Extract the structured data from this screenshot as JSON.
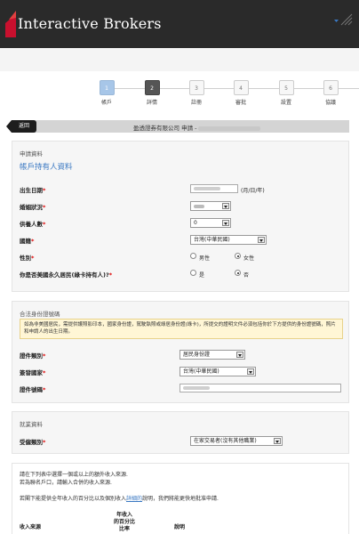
{
  "header": {
    "brand": "Interactive Brokers"
  },
  "steps": [
    {
      "number": "1",
      "label": "帳戶"
    },
    {
      "number": "2",
      "label": "詳情"
    },
    {
      "number": "3",
      "label": "註冊"
    },
    {
      "number": "4",
      "label": "審批"
    },
    {
      "number": "5",
      "label": "設置"
    },
    {
      "number": "6",
      "label": "協議"
    }
  ],
  "form_header": {
    "back_label": "返回",
    "title": "盈透證券有限公司 申請 -"
  },
  "applicant": {
    "section_title": "申請資料",
    "subtitle": "帳戶持有人資料",
    "dob_label": "出生日期",
    "dob_format": "(月/日/年)",
    "marital_label": "婚姻狀況",
    "dependents_label": "供養人數",
    "dependents_value": "0",
    "country_label": "國籍",
    "country_value": "台灣(中華民國)",
    "gender_label": "性別",
    "gender_male": "男性",
    "gender_female": "女性",
    "pr_label": "你是否美國永久居民(綠卡持有人)?",
    "pr_yes": "是",
    "pr_no": "否"
  },
  "identity": {
    "section_title": "合法身份證號碼",
    "notice": "如為非美國居民，需提供護照影印本，國家身份證，駕駛執照或綠居身份證(綠卡)，所提交的證明文件必須包括你於下方提供的身份證號碼，照片和申請人的出生日期。",
    "doc_type_label": "證件類別",
    "doc_type_value": "居民身份證",
    "issuing_country_label": "簽發國家",
    "issuing_country_value": "台灣(中華民國)",
    "doc_number_label": "證件號碼"
  },
  "employment": {
    "section_title": "就業資料",
    "type_label": "受僱類別",
    "type_value": "在家交易者(沒有其他職業)"
  },
  "income": {
    "line1": "請在下列表中選擇一個或以上的額外收入來源.",
    "line2": "若為聯名戶口，請輸入合併的收入來源.",
    "line3_a": "若閣下能提供全年收入的百分比以及個別收入",
    "line3_link": "詳細的",
    "line3_b": "說明，我們將能更快地批准申請.",
    "col_source": "收入來源",
    "col_percent_1": "年收入",
    "col_percent_2": "的百分比",
    "col_percent_3": "比率",
    "col_desc": "說明"
  }
}
